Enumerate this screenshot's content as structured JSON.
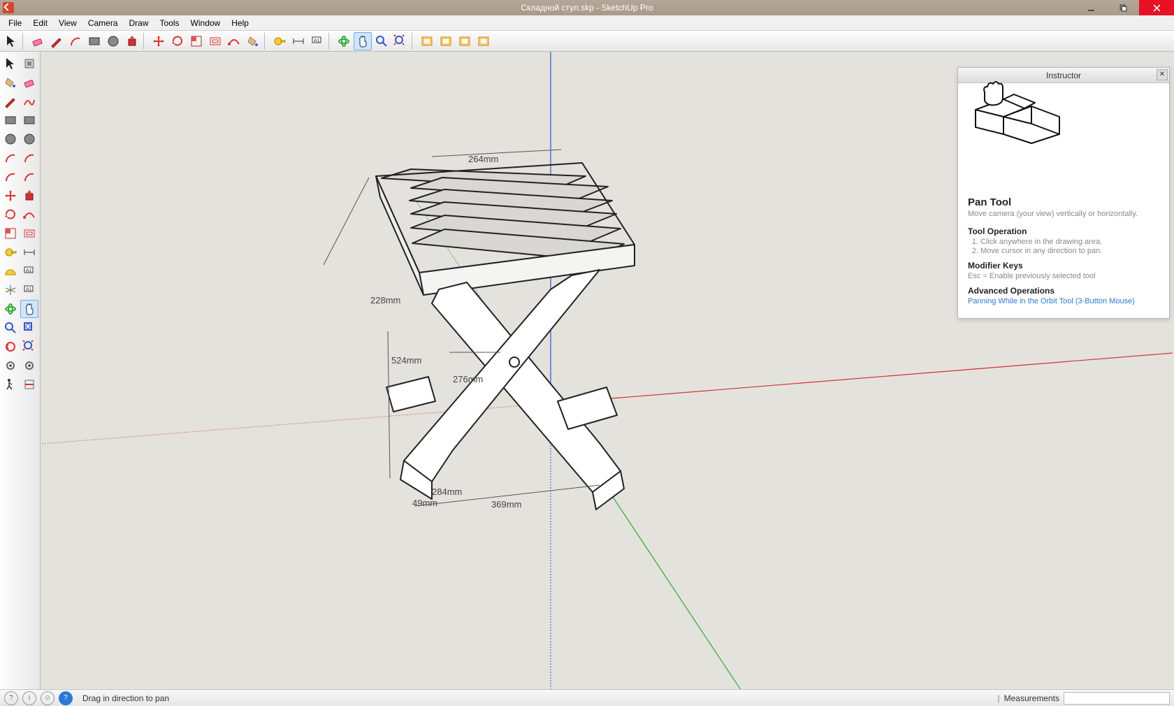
{
  "window": {
    "title": "Складной стул.skp - SketchUp Pro"
  },
  "menu": [
    "File",
    "Edit",
    "View",
    "Camera",
    "Draw",
    "Tools",
    "Window",
    "Help"
  ],
  "toolbar_top": [
    {
      "name": "select-arrow-icon",
      "interact": true
    },
    {
      "sep": true
    },
    {
      "name": "eraser-icon",
      "interact": true
    },
    {
      "name": "pencil-icon",
      "interact": true
    },
    {
      "name": "arc-icon",
      "interact": true
    },
    {
      "name": "rectangle-icon",
      "interact": true
    },
    {
      "name": "circle-icon",
      "interact": true
    },
    {
      "name": "push-pull-icon",
      "interact": true
    },
    {
      "sep": true
    },
    {
      "name": "move-icon",
      "interact": true
    },
    {
      "name": "rotate-icon",
      "interact": true
    },
    {
      "name": "scale-icon",
      "interact": true
    },
    {
      "name": "offset-icon",
      "interact": true
    },
    {
      "name": "follow-me-icon",
      "interact": true
    },
    {
      "name": "paint-bucket-icon",
      "interact": true
    },
    {
      "sep": true
    },
    {
      "name": "tape-measure-icon",
      "interact": true
    },
    {
      "name": "dimension-icon",
      "interact": true
    },
    {
      "name": "text-icon",
      "interact": true
    },
    {
      "sep": true
    },
    {
      "name": "orbit-icon",
      "interact": true
    },
    {
      "name": "pan-icon",
      "interact": true,
      "active": true
    },
    {
      "name": "zoom-icon",
      "interact": true
    },
    {
      "name": "zoom-extents-icon",
      "interact": true
    },
    {
      "sep": true
    },
    {
      "name": "add-location-icon",
      "interact": true
    },
    {
      "name": "3d-warehouse-icon",
      "interact": true
    },
    {
      "name": "extension-warehouse-icon",
      "interact": true
    },
    {
      "name": "layout-icon",
      "interact": true
    }
  ],
  "toolbar_left_rows": [
    [
      "select-icon",
      "make-component-icon"
    ],
    [
      "paint-bucket-icon",
      "eraser-icon"
    ],
    [
      "line-icon",
      "freehand-icon"
    ],
    [
      "rectangle-icon",
      "rotated-rect-icon"
    ],
    [
      "circle-icon",
      "polygon-icon"
    ],
    [
      "arc-icon",
      "2pt-arc-icon"
    ],
    [
      "3pt-arc-icon",
      "pie-icon"
    ],
    [
      "move-icon",
      "push-pull-icon"
    ],
    [
      "rotate-icon",
      "follow-me-icon"
    ],
    [
      "scale-icon",
      "offset-icon"
    ],
    [
      "tape-icon",
      "dimension-icon"
    ],
    [
      "protractor-icon",
      "text-icon"
    ],
    [
      "axes-icon",
      "3d-text-icon"
    ],
    [
      "orbit-icon",
      "pan-icon"
    ],
    [
      "zoom-icon",
      "zoom-window-icon"
    ],
    [
      "previous-icon",
      "zoom-extents-icon"
    ],
    [
      "position-camera-icon",
      "look-around-icon"
    ],
    [
      "walk-icon",
      "section-plane-icon"
    ]
  ],
  "dimensions": {
    "d264": "264mm",
    "d228": "228mm",
    "d524": "524mm",
    "d276": "276mm",
    "d284": "284mm",
    "d49": "49mm",
    "d369": "369mm"
  },
  "instructor": {
    "title": "Instructor",
    "tool_name": "Pan Tool",
    "tool_desc": "Move camera (your view) vertically or horizontally.",
    "op_heading": "Tool Operation",
    "op_steps": [
      "Click anywhere in the drawing area.",
      "Move cursor in any direction to pan."
    ],
    "mk_heading": "Modifier Keys",
    "mk_text": "Esc = Enable previously selected tool",
    "adv_heading": "Advanced Operations",
    "adv_link": "Panning While in the Orbit Tool (3-Button Mouse)"
  },
  "status": {
    "message": "Drag in direction to pan",
    "meas_label": "Measurements"
  }
}
